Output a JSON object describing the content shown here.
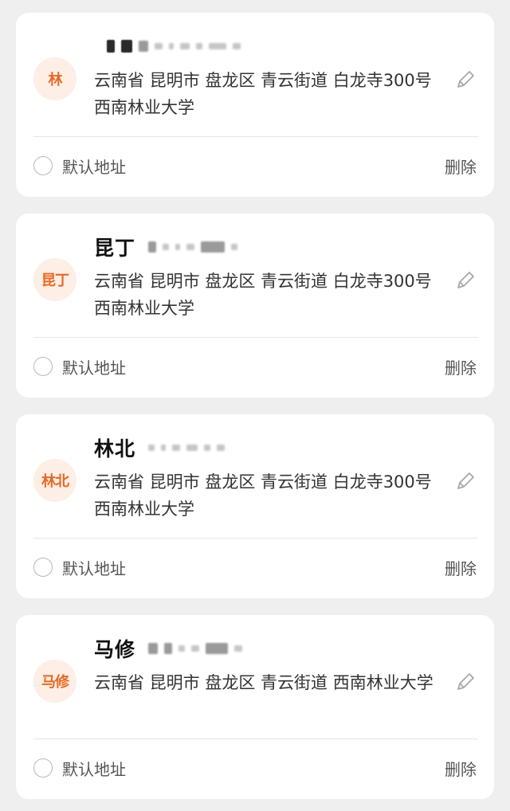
{
  "addresses": [
    {
      "avatar": "林",
      "name": "",
      "address": "云南省 昆明市 盘龙区 青云街道 白龙寺300号西南林业大学",
      "default_label": "默认地址",
      "delete_label": "删除"
    },
    {
      "avatar": "昆丁",
      "name": "昆丁",
      "address": "云南省 昆明市 盘龙区 青云街道 白龙寺300号西南林业大学",
      "default_label": "默认地址",
      "delete_label": "删除"
    },
    {
      "avatar": "林北",
      "name": "林北",
      "address": "云南省 昆明市 盘龙区 青云街道 白龙寺300号西南林业大学",
      "default_label": "默认地址",
      "delete_label": "删除"
    },
    {
      "avatar": "马修",
      "name": "马修",
      "address": "云南省 昆明市 盘龙区 青云街道 西南林业大学",
      "default_label": "默认地址",
      "delete_label": "删除"
    }
  ],
  "icons": {
    "edit": "pencil-icon",
    "default_toggle": "radio-circle-icon"
  },
  "colors": {
    "accent": "#e56a24",
    "avatar_bg": "#fdeee6",
    "page_bg": "#efefef",
    "card_bg": "#ffffff"
  }
}
